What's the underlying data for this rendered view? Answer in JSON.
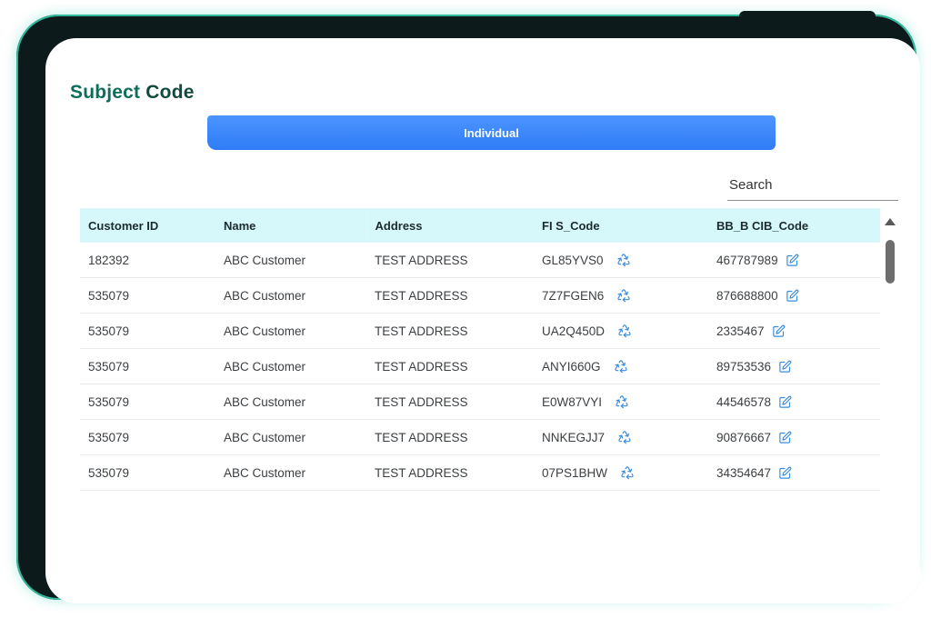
{
  "page": {
    "title_word1": "Subject",
    "title_word2": "Code"
  },
  "tabs": [
    {
      "label": "Individual",
      "active": true
    }
  ],
  "search": {
    "placeholder": "Search",
    "value": ""
  },
  "table": {
    "columns": [
      "Customer ID",
      "Name",
      "Address",
      "FI S_Code",
      "BB_B CIB_Code"
    ],
    "rows": [
      {
        "customer_id": "182392",
        "name": "ABC Customer",
        "address": "TEST ADDRESS",
        "fi_code": "GL85YVS0",
        "cib_code": "467787989"
      },
      {
        "customer_id": "535079",
        "name": "ABC Customer",
        "address": "TEST ADDRESS",
        "fi_code": "7Z7FGEN6",
        "cib_code": "876688800"
      },
      {
        "customer_id": "535079",
        "name": "ABC Customer",
        "address": "TEST ADDRESS",
        "fi_code": "UA2Q450D",
        "cib_code": "2335467"
      },
      {
        "customer_id": "535079",
        "name": "ABC Customer",
        "address": "TEST ADDRESS",
        "fi_code": "ANYI660G",
        "cib_code": "89753536"
      },
      {
        "customer_id": "535079",
        "name": "ABC Customer",
        "address": "TEST ADDRESS",
        "fi_code": "E0W87VYI",
        "cib_code": "44546578"
      },
      {
        "customer_id": "535079",
        "name": "ABC Customer",
        "address": "TEST ADDRESS",
        "fi_code": "NNKEGJJ7",
        "cib_code": "90876667"
      },
      {
        "customer_id": "535079",
        "name": "ABC Customer",
        "address": "TEST ADDRESS",
        "fi_code": "07PS1BHW",
        "cib_code": "34354647"
      }
    ]
  },
  "icons": {
    "fi_code_action": "recycle-icon",
    "cib_code_action": "edit-icon"
  },
  "colors": {
    "accent": "#2f7cf6",
    "header_bg": "#d6f8fb",
    "title": "#0e6e5c",
    "icon": "#3a8dde",
    "device_border": "#2fb89a"
  }
}
